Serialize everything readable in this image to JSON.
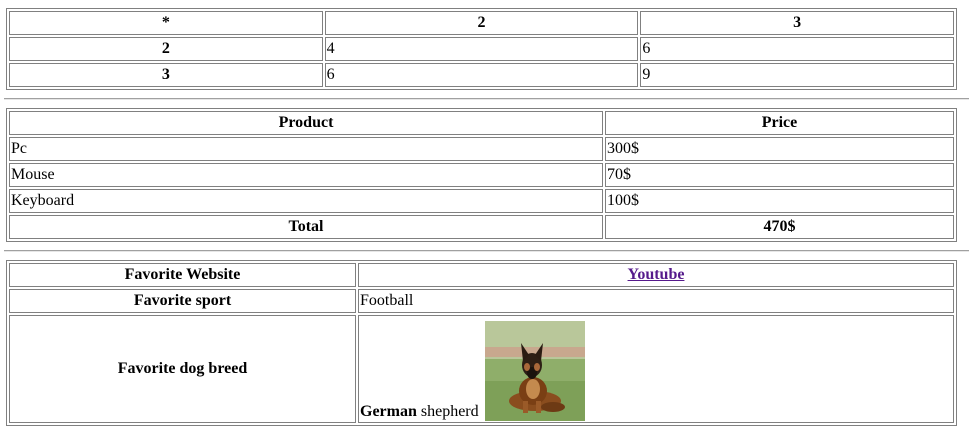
{
  "table1": {
    "header": [
      "*",
      "2",
      "3"
    ],
    "rows": [
      {
        "head": "2",
        "cells": [
          "4",
          "6"
        ]
      },
      {
        "head": "3",
        "cells": [
          "6",
          "9"
        ]
      }
    ]
  },
  "table2": {
    "header": [
      "Product",
      "Price"
    ],
    "rows": [
      {
        "product": "Pc",
        "price": "300$"
      },
      {
        "product": "Mouse",
        "price": "70$"
      },
      {
        "product": "Keyboard",
        "price": "100$"
      }
    ],
    "total_label": "Total",
    "total_value": "470$"
  },
  "table3": {
    "website_label": "Favorite Website",
    "website_value": "Youtube",
    "sport_label": "Favorite sport",
    "sport_value": "Football",
    "dog_label": "Favorite dog breed",
    "dog_value_bold": "German",
    "dog_value_rest": " shepherd"
  },
  "colors": {
    "border": "#808080",
    "link_visited": "#551a8b"
  },
  "icons": {
    "dog_image": "german-shepherd-photo"
  }
}
